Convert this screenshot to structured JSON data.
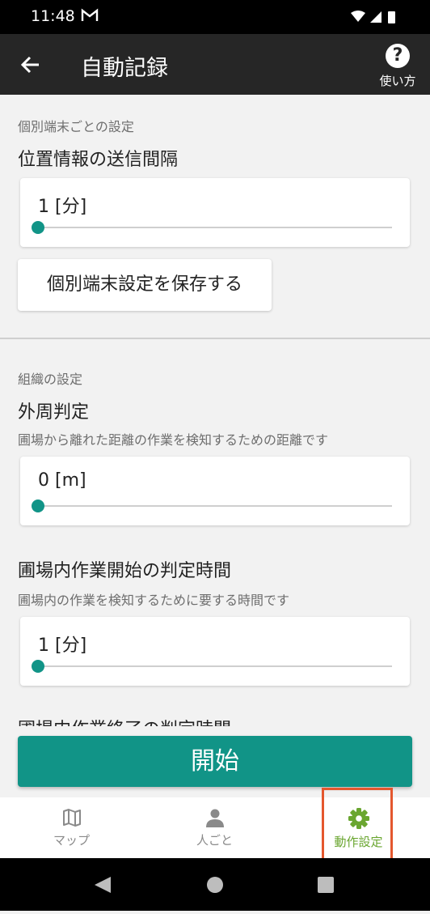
{
  "status_bar": {
    "time": "11:48"
  },
  "app_bar": {
    "title": "自動記録",
    "help_label": "使い方"
  },
  "individual": {
    "section_label": "個別端末ごとの設定",
    "interval": {
      "title": "位置情報の送信間隔",
      "value_text": "1 [分]",
      "slider_fraction": 0.0
    },
    "save_button": "個別端末設定を保存する"
  },
  "organization": {
    "section_label": "組織の設定",
    "perimeter": {
      "title": "外周判定",
      "description": "圃場から離れた距離の作業を検知するための距離です",
      "value_text": "0 [m]",
      "slider_fraction": 0.0
    },
    "start_time": {
      "title": "圃場内作業開始の判定時間",
      "description": "圃場内の作業を検知するために要する時間です",
      "value_text": "1 [分]",
      "slider_fraction": 0.0
    },
    "end_time": {
      "title": "圃場内作業終了の判定時間"
    }
  },
  "start_button": "開始",
  "bottom_nav": [
    {
      "label": "マップ",
      "icon": "map-icon",
      "active": false
    },
    {
      "label": "人ごと",
      "icon": "person-icon",
      "active": false
    },
    {
      "label": "動作設定",
      "icon": "gear-icon",
      "active": true
    }
  ],
  "colors": {
    "accent": "#119487",
    "active_nav": "#6aa630",
    "highlight": "#e4572e",
    "app_bar": "#262626"
  }
}
